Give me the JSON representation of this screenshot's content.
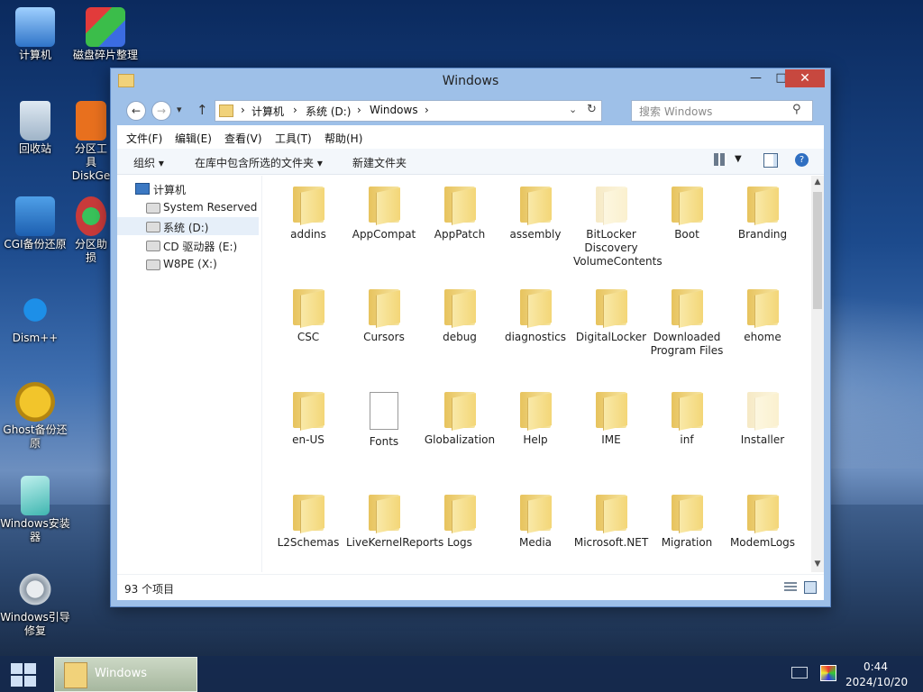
{
  "desktop": {
    "icons": [
      {
        "label": "计算机",
        "icon": "computer-icon"
      },
      {
        "label": "磁盘碎片整理",
        "icon": "disk-defrag-icon"
      },
      {
        "label": "回收站",
        "icon": "recycle-bin-icon"
      },
      {
        "label": "分区工具DiskGe",
        "icon": "diskgenius-icon"
      },
      {
        "label": "CGI备份还原",
        "icon": "cgi-backup-icon"
      },
      {
        "label": "分区助损",
        "icon": "partition-assistant-icon"
      },
      {
        "label": "Dism++",
        "icon": "dism-icon"
      },
      {
        "label": "Ghost备份还原",
        "icon": "ghost-icon"
      },
      {
        "label": "Windows安装器",
        "icon": "windows-installer-icon"
      },
      {
        "label": "Windows引导修复",
        "icon": "boot-repair-icon"
      }
    ]
  },
  "window": {
    "title": "Windows",
    "controls": {
      "minimize": "—",
      "maximize": "□",
      "close": "✕"
    },
    "nav": {
      "back": "←",
      "forward": "→",
      "dropdown": "▾",
      "up": "↑"
    },
    "address": {
      "crumbs": [
        "计算机",
        "系统 (D:)",
        "Windows"
      ],
      "separator": "›"
    },
    "search": {
      "placeholder": "搜索 Windows"
    },
    "menus": [
      "文件(F)",
      "编辑(E)",
      "查看(V)",
      "工具(T)",
      "帮助(H)"
    ],
    "toolbar": {
      "organize": "组织 ▾",
      "include_library": "在库中包含所选的文件夹 ▾",
      "new_folder": "新建文件夹"
    },
    "sidebar": {
      "root": "计算机",
      "drives": [
        "System Reserved (",
        "系统 (D:)",
        "CD 驱动器 (E:)",
        "W8PE (X:)"
      ],
      "selected_index": 1
    },
    "items": [
      {
        "name": "addins",
        "type": "folder"
      },
      {
        "name": "AppCompat",
        "type": "folder"
      },
      {
        "name": "AppPatch",
        "type": "folder"
      },
      {
        "name": "assembly",
        "type": "folder"
      },
      {
        "name": "BitLocker Discovery VolumeContents",
        "type": "folder-hidden"
      },
      {
        "name": "Boot",
        "type": "folder"
      },
      {
        "name": "Branding",
        "type": "folder"
      },
      {
        "name": "CSC",
        "type": "folder"
      },
      {
        "name": "Cursors",
        "type": "folder"
      },
      {
        "name": "debug",
        "type": "folder"
      },
      {
        "name": "diagnostics",
        "type": "folder"
      },
      {
        "name": "DigitalLocker",
        "type": "folder"
      },
      {
        "name": "Downloaded Program Files",
        "type": "folder"
      },
      {
        "name": "ehome",
        "type": "folder"
      },
      {
        "name": "en-US",
        "type": "folder"
      },
      {
        "name": "Fonts",
        "type": "file"
      },
      {
        "name": "Globalization",
        "type": "folder"
      },
      {
        "name": "Help",
        "type": "folder"
      },
      {
        "name": "IME",
        "type": "folder"
      },
      {
        "name": "inf",
        "type": "folder"
      },
      {
        "name": "Installer",
        "type": "folder-hidden"
      },
      {
        "name": "L2Schemas",
        "type": "folder"
      },
      {
        "name": "LiveKernelReports",
        "type": "folder"
      },
      {
        "name": "Logs",
        "type": "folder"
      },
      {
        "name": "Media",
        "type": "folder"
      },
      {
        "name": "Microsoft.NET",
        "type": "folder"
      },
      {
        "name": "Migration",
        "type": "folder"
      },
      {
        "name": "ModemLogs",
        "type": "folder"
      },
      {
        "name": "",
        "type": "folder"
      },
      {
        "name": "",
        "type": "folder"
      },
      {
        "name": "",
        "type": "folder"
      },
      {
        "name": "",
        "type": "folder"
      },
      {
        "name": "",
        "type": "folder"
      },
      {
        "name": "",
        "type": "folder"
      },
      {
        "name": "",
        "type": "folder"
      }
    ],
    "status": {
      "count": "93 个项目"
    }
  },
  "taskbar": {
    "app_label": "Windows",
    "time": "0:44",
    "date": "2024/10/20"
  }
}
